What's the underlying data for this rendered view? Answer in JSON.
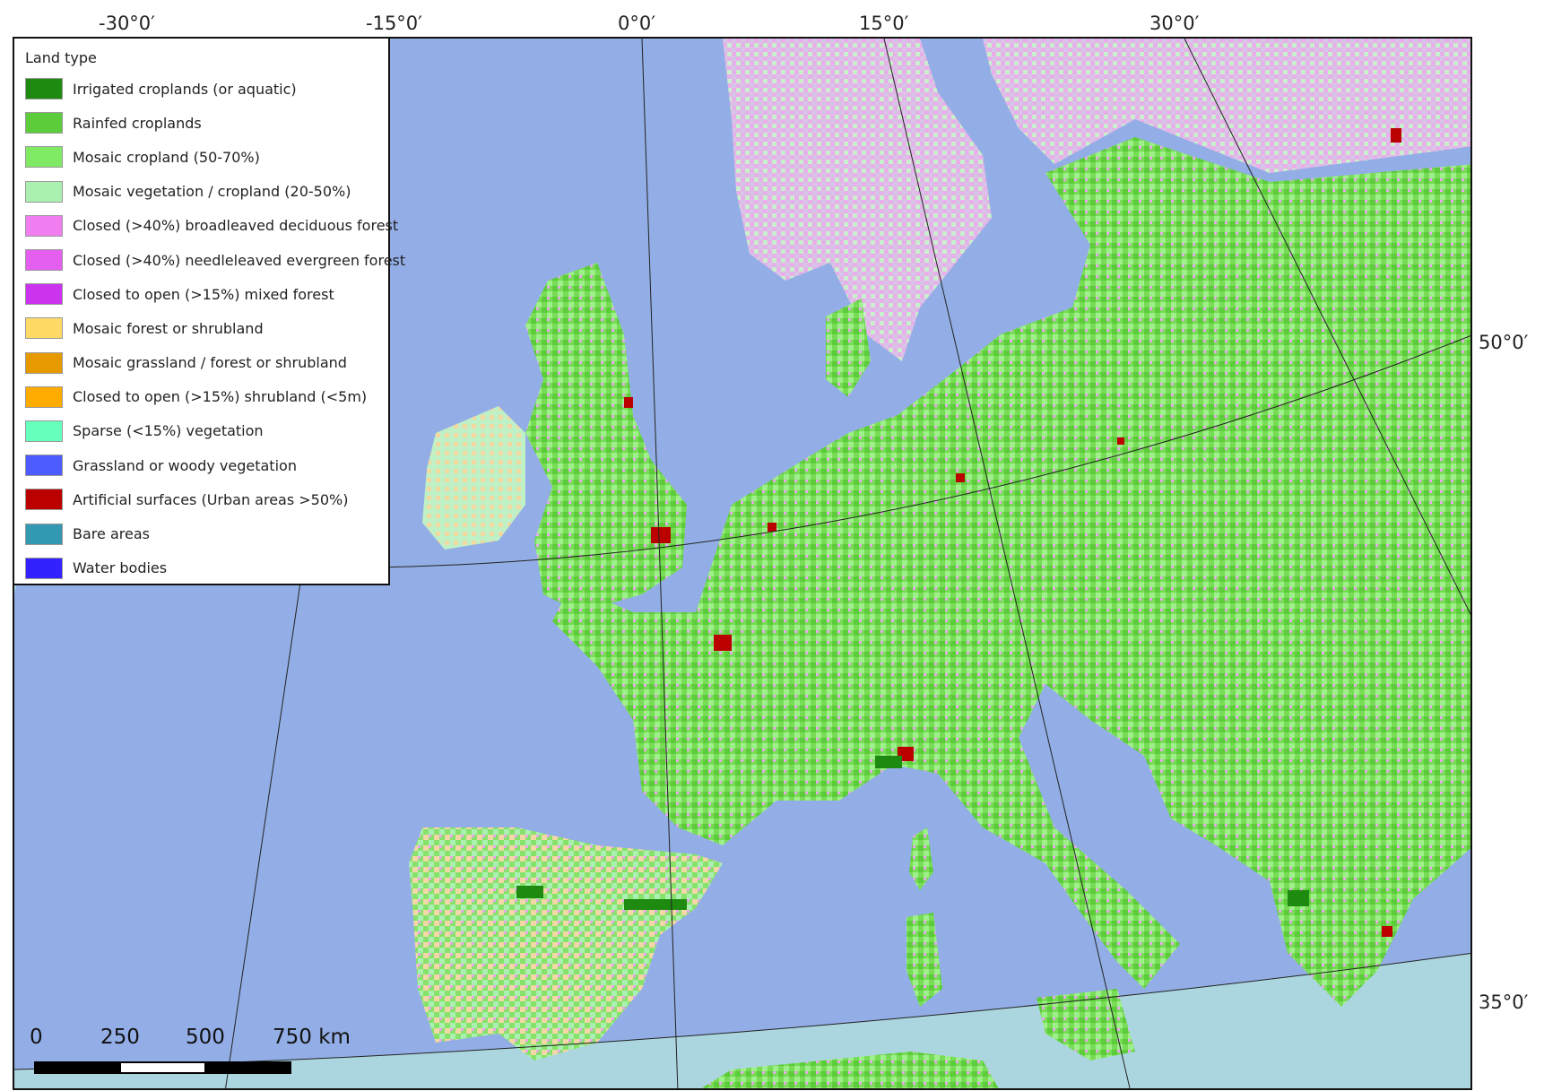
{
  "graticule": {
    "top_labels": [
      "-30°0′",
      "-15°0′",
      "0°0′",
      "15°0′",
      "30°0′"
    ],
    "right_labels": [
      "50°0′",
      "35°0′"
    ]
  },
  "legend": {
    "title": "Land type",
    "items": [
      {
        "label": "Irrigated croplands (or aquatic)",
        "color": "#1e8a0f"
      },
      {
        "label": "Rainfed croplands",
        "color": "#5ccc3a"
      },
      {
        "label": "Mosaic cropland (50-70%)",
        "color": "#80ea64"
      },
      {
        "label": "Mosaic vegetation / cropland (20-50%)",
        "color": "#aaf0b0"
      },
      {
        "label": "Closed (>40%) broadleaved deciduous forest",
        "color": "#f07ef0"
      },
      {
        "label": "Closed (>40%) needleleaved evergreen forest",
        "color": "#e45ef0"
      },
      {
        "label": "Closed to open (>15%) mixed forest",
        "color": "#cc33ee"
      },
      {
        "label": "Mosaic forest or shrubland",
        "color": "#ffd966"
      },
      {
        "label": "Mosaic grassland / forest or shrubland",
        "color": "#e69a00"
      },
      {
        "label": "Closed to open (>15%) shrubland (<5m)",
        "color": "#ffab00"
      },
      {
        "label": "Sparse (<15%) vegetation",
        "color": "#66ffbb"
      },
      {
        "label": "Grassland or woody vegetation",
        "color": "#4c5cff"
      },
      {
        "label": "Artificial surfaces (Urban areas >50%)",
        "color": "#bb0000"
      },
      {
        "label": "Bare areas",
        "color": "#3399b3"
      },
      {
        "label": "Water bodies",
        "color": "#3322ff"
      }
    ]
  },
  "scale_bar": {
    "ticks": [
      "0",
      "250",
      "500",
      "750 km"
    ]
  },
  "colors": {
    "sea": "#93aee6",
    "outer_water": "#acd6df",
    "land_base": "#7ee060",
    "urban": "#bb0000",
    "forest": "#e9a6ee",
    "shrub": "#f3d9a0"
  }
}
